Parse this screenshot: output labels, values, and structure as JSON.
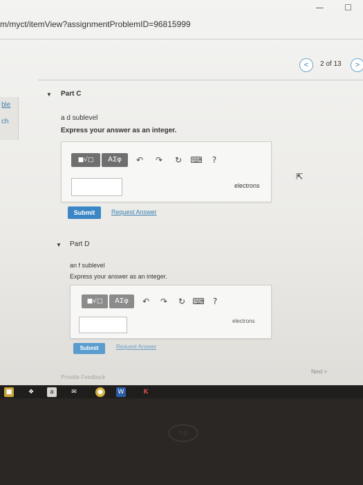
{
  "window": {
    "minimize_icon": "minimize-icon",
    "maximize_icon": "maximize-icon"
  },
  "browser": {
    "url": "m/myct/itemView?assignmentProblemID=96815999"
  },
  "pager": {
    "prev": "<",
    "count": "2 of 13",
    "next": ">"
  },
  "left_panel": {
    "line1": "ble",
    "line2": "ch"
  },
  "partC": {
    "label": "Part C",
    "prompt": "a d sublevel",
    "instruction": "Express your answer as an integer.",
    "toolbar": {
      "template": "■√□",
      "greek": "ΑΣφ",
      "undo": "↶",
      "redo": "↷",
      "reset": "↻",
      "keyboard": "⌨",
      "help": "?"
    },
    "units": "electrons",
    "submit": "Submit",
    "request_answer": "Request Answer"
  },
  "partD": {
    "label": "Part D",
    "prompt": "an f sublevel",
    "instruction": "Express your answer as an integer.",
    "toolbar": {
      "template": "■√□",
      "greek": "ΑΣφ",
      "undo": "↶",
      "redo": "↷",
      "reset": "↻",
      "keyboard": "⌨",
      "help": "?"
    },
    "units": "electrons",
    "submit": "Submit",
    "request_answer": "Request Answer"
  },
  "footer": {
    "provide_feedback": "Provide Feedback",
    "next": "Next >"
  },
  "taskbar": {
    "icons": [
      "lock-icon",
      "dropbox-icon",
      "amazon-icon",
      "mail-icon",
      "chrome-icon",
      "word-icon",
      "k-app-icon"
    ]
  },
  "bezel": {
    "logo": "hp"
  },
  "colors": {
    "accent": "#3b86c4",
    "link": "#3b7fb0",
    "toolbar": "#6f6f6f"
  }
}
